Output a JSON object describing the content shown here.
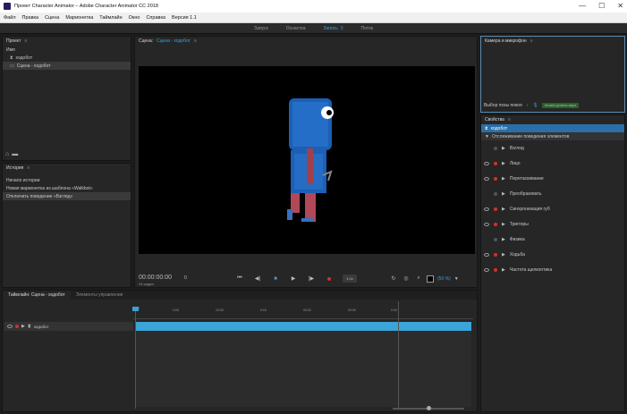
{
  "window": {
    "title": "Проект Character Animator – Adobe Character Animator CC 2018",
    "controls": [
      "—",
      "☐",
      "✕"
    ]
  },
  "menu": [
    "Файл",
    "Правка",
    "Сцена",
    "Марионетка",
    "Таймлайн",
    "Окно",
    "Справка",
    "Версия 1.1"
  ],
  "modes": [
    {
      "label": "Запуск",
      "active": false
    },
    {
      "label": "Оснастка",
      "active": false
    },
    {
      "label": "Запись",
      "active": true
    },
    {
      "label": "Поток",
      "active": false
    }
  ],
  "mode_badge": "3",
  "project": {
    "title": "Проект",
    "name_header": "Имя",
    "items": [
      {
        "label": "ходобот",
        "selected": false
      },
      {
        "label": "Сцена - ходобот",
        "selected": true
      }
    ]
  },
  "history": {
    "title": "История",
    "items": [
      {
        "label": "Начало истории",
        "selected": false
      },
      {
        "label": "Новая марионетка из шаблона «Walkbot»",
        "selected": false
      },
      {
        "label": "Отключить поведение «Взгляд»",
        "selected": true
      }
    ]
  },
  "scene": {
    "title_prefix": "Сцена:",
    "title_name": "Сцена - ходобот",
    "timecode": "00:00:00:00",
    "fps": "24 кадр/с",
    "frame": "0",
    "speed": "1,0x",
    "zoom": "(50 %)"
  },
  "camera": {
    "title": "Камера и микрофон",
    "rest_pose_label": "Выбор позы покоя",
    "mic_status": "Низкий уровень звука"
  },
  "properties": {
    "title": "Свойства",
    "puppet": "ходобот",
    "section": "Отслеживание поведения элементов",
    "behaviors": [
      {
        "label": "Взгляд",
        "enabled": false
      },
      {
        "label": "Лицо",
        "enabled": true
      },
      {
        "label": "Перетаскивание",
        "enabled": true
      },
      {
        "label": "Преобразовать",
        "enabled": false
      },
      {
        "label": "Синхронизация губ",
        "enabled": true
      },
      {
        "label": "Триггеры",
        "enabled": true
      },
      {
        "label": "Физика",
        "enabled": false
      },
      {
        "label": "Ходьба",
        "enabled": true
      },
      {
        "label": "Частота щелкоптика",
        "enabled": true
      }
    ]
  },
  "timeline": {
    "tabs": [
      {
        "label": "Таймлайн: Сцена - ходобот",
        "active": true
      },
      {
        "label": "Элементы управления",
        "active": false
      }
    ],
    "ruler_left": "0:00",
    "ruler_ticks": [
      "0:05",
      "10:00",
      "0:15",
      "00:20",
      "00:25",
      "0:30"
    ],
    "track": "ходобот"
  },
  "colors": {
    "accent": "#3ba0d6",
    "track_bar": "#3aa5d8",
    "playhead": "#d02020",
    "record": "#d03030"
  }
}
